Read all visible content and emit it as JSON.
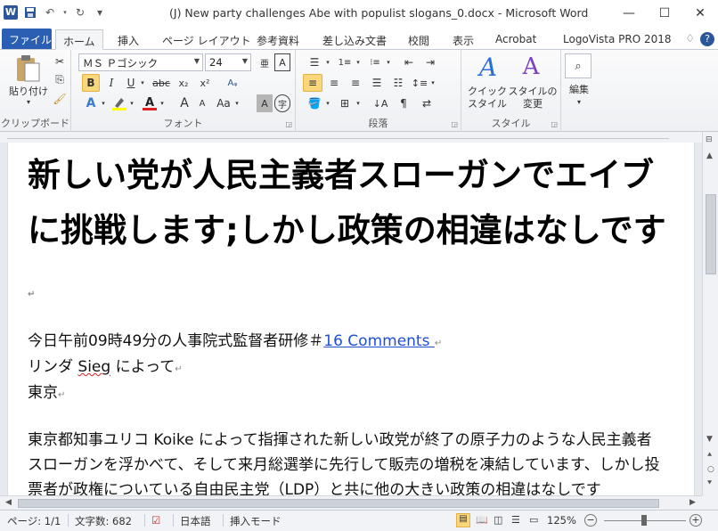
{
  "window": {
    "title": "(J) New party challenges Abe with populist slogans_0.docx - Microsoft Word",
    "app_icon": "W"
  },
  "qat": {
    "save": "💾",
    "undo": "↶",
    "redo": "↻",
    "customize": "▾"
  },
  "win_controls": {
    "minimize": "—",
    "maximize": "☐",
    "close": "✕"
  },
  "tabs": [
    {
      "label": "ファイル"
    },
    {
      "label": "ホーム"
    },
    {
      "label": "挿入"
    },
    {
      "label": "ページ レイアウト"
    },
    {
      "label": "参考資料"
    },
    {
      "label": "差し込み文書"
    },
    {
      "label": "校閲"
    },
    {
      "label": "表示"
    },
    {
      "label": "Acrobat"
    },
    {
      "label": "LogoVista PRO 2018"
    }
  ],
  "tab_right": {
    "collapse": "♢",
    "help": "?"
  },
  "ribbon": {
    "clipboard": {
      "paste_label": "貼り付け",
      "paste_arrow": "▾",
      "group": "クリップボード"
    },
    "font": {
      "name": "ＭＳ Ｐゴシック",
      "size": "24",
      "bold": "B",
      "italic": "I",
      "underline": "U",
      "strike": "abc",
      "subscript": "x₂",
      "superscript": "x²",
      "grow": "A",
      "shrink": "A",
      "case": "Aa",
      "shade": "A",
      "enclose": "字",
      "group": "フォント"
    },
    "paragraph": {
      "group": "段落"
    },
    "styles": {
      "quick_label": "クイック\nスタイル",
      "change_label": "スタイルの\n変更",
      "group": "スタイル"
    },
    "editing": {
      "label": "編集"
    }
  },
  "document": {
    "title": "新しい党が人民主義者スローガンでエイブに挑戦します;しかし政策の相違はなしです",
    "dateline": "今日午前09時49分の人事院式監督者研修＃",
    "comments_link": "16 Comments ",
    "byline_prefix": "リンダ ",
    "byline_name": "Sieg",
    "byline_suffix": " によって",
    "location": "東京",
    "paragraph_mark": "↵",
    "body": "東京都知事ユリコ Koike によって指揮された新しい政党が終了の原子力のような人民主義者スローガンを浮かべて、そして来月総選挙に先行して販売の増税を凍結しています、しかし投票者が政権についている自由民主党（LDP）と共に他の大きい政策の相違はなしです"
  },
  "status": {
    "page": "ページ: 1/1",
    "words": "文字数: 682",
    "language": "日本語",
    "mode": "挿入モード",
    "zoom": "125%",
    "zoom_minus": "−",
    "zoom_plus": "+"
  }
}
